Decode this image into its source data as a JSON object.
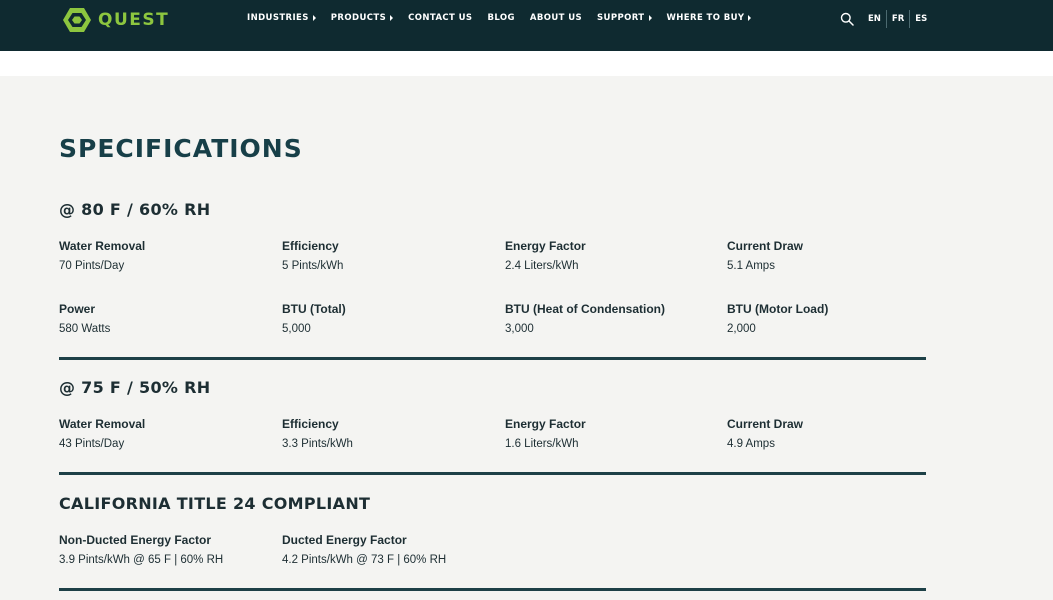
{
  "header": {
    "logo_text": "QUEST",
    "nav": [
      {
        "label": "INDUSTRIES",
        "dropdown": true
      },
      {
        "label": "PRODUCTS",
        "dropdown": true
      },
      {
        "label": "CONTACT US",
        "dropdown": false
      },
      {
        "label": "BLOG",
        "dropdown": false
      },
      {
        "label": "ABOUT US",
        "dropdown": false
      },
      {
        "label": "SUPPORT",
        "dropdown": true
      },
      {
        "label": "WHERE TO BUY",
        "dropdown": true
      }
    ],
    "languages": [
      "EN",
      "FR",
      "ES"
    ]
  },
  "page": {
    "title": "SPECIFICATIONS"
  },
  "sections": [
    {
      "title": "@ 80 F / 60% RH",
      "specs": [
        {
          "label": "Water Removal",
          "value": "70 Pints/Day"
        },
        {
          "label": "Efficiency",
          "value": "5 Pints/kWh"
        },
        {
          "label": "Energy Factor",
          "value": "2.4 Liters/kWh"
        },
        {
          "label": "Current Draw",
          "value": "5.1 Amps"
        },
        {
          "label": "Power",
          "value": "580 Watts"
        },
        {
          "label": "BTU (Total)",
          "value": "5,000"
        },
        {
          "label": "BTU (Heat of Condensation)",
          "value": "3,000"
        },
        {
          "label": "BTU (Motor Load)",
          "value": "2,000"
        }
      ]
    },
    {
      "title": "@ 75 F / 50% RH",
      "specs": [
        {
          "label": "Water Removal",
          "value": "43 Pints/Day"
        },
        {
          "label": "Efficiency",
          "value": "3.3 Pints/kWh"
        },
        {
          "label": "Energy Factor",
          "value": "1.6 Liters/kWh"
        },
        {
          "label": "Current Draw",
          "value": "4.9 Amps"
        }
      ]
    },
    {
      "title": "CALIFORNIA TITLE 24 COMPLIANT",
      "specs": [
        {
          "label": "Non-Ducted Energy Factor",
          "value": "3.9 Pints/kWh @ 65 F | 60% RH"
        },
        {
          "label": "Ducted Energy Factor",
          "value": "4.2 Pints/kWh @ 73 F | 60% RH"
        }
      ]
    }
  ],
  "colors": {
    "header_bg": "#0f2a30",
    "logo_green": "#8dc63f",
    "title_teal": "#173f48",
    "rule": "#1d4047"
  }
}
